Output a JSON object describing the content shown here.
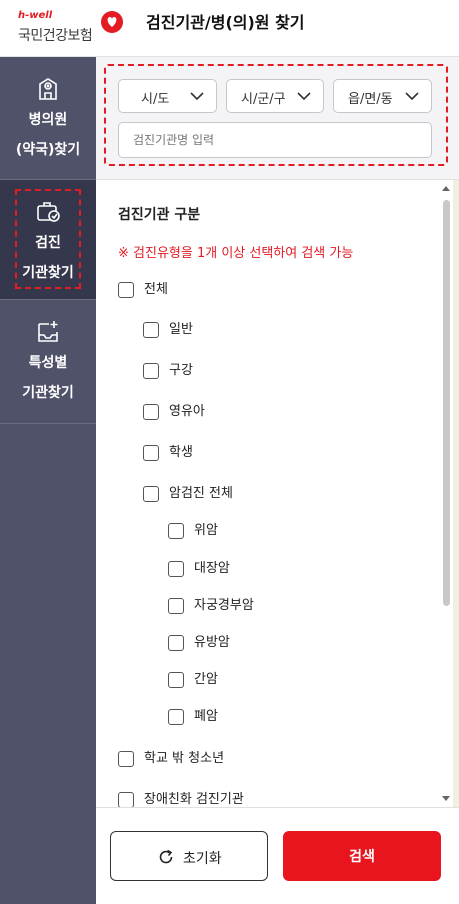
{
  "header": {
    "brand_small": "h-well",
    "brand_name": "국민건강보험",
    "title": "검진기관/병(의)원 찾기"
  },
  "sidebar": {
    "items": [
      {
        "line1": "병의원",
        "line2": "(약국)찾기",
        "icon": "hospital-icon",
        "active": false
      },
      {
        "line1": "검진",
        "line2": "기관찾기",
        "icon": "medical-bag-icon",
        "active": true
      },
      {
        "line1": "특성별",
        "line2": "기관찾기",
        "icon": "tray-plus-icon",
        "active": false
      }
    ]
  },
  "search": {
    "selects": [
      "시/도",
      "시/군/구",
      "읍/면/동"
    ],
    "input_placeholder": "검진기관명 입력"
  },
  "filter": {
    "section_title": "검진기관 구분",
    "note": "※ 검진유형을 1개 이상 선택하여 검색 가능",
    "options": [
      {
        "label": "전체",
        "level": 0
      },
      {
        "label": "일반",
        "level": 1
      },
      {
        "label": "구강",
        "level": 1
      },
      {
        "label": "영유아",
        "level": 1
      },
      {
        "label": "학생",
        "level": 1
      },
      {
        "label": "암검진 전체",
        "level": 1
      },
      {
        "label": "위암",
        "level": 2
      },
      {
        "label": "대장암",
        "level": 2
      },
      {
        "label": "자궁경부암",
        "level": 2
      },
      {
        "label": "유방암",
        "level": 2
      },
      {
        "label": "간암",
        "level": 2
      },
      {
        "label": "폐암",
        "level": 2
      },
      {
        "label": "학교 밖 청소년",
        "level": 0
      },
      {
        "label": "장애친화 검진기관",
        "level": 0
      }
    ]
  },
  "footer": {
    "reset_label": "초기화",
    "search_label": "검색"
  },
  "colors": {
    "accent": "#e8141e",
    "sidebar_bg": "#50526a",
    "sidebar_active": "#35374c"
  }
}
